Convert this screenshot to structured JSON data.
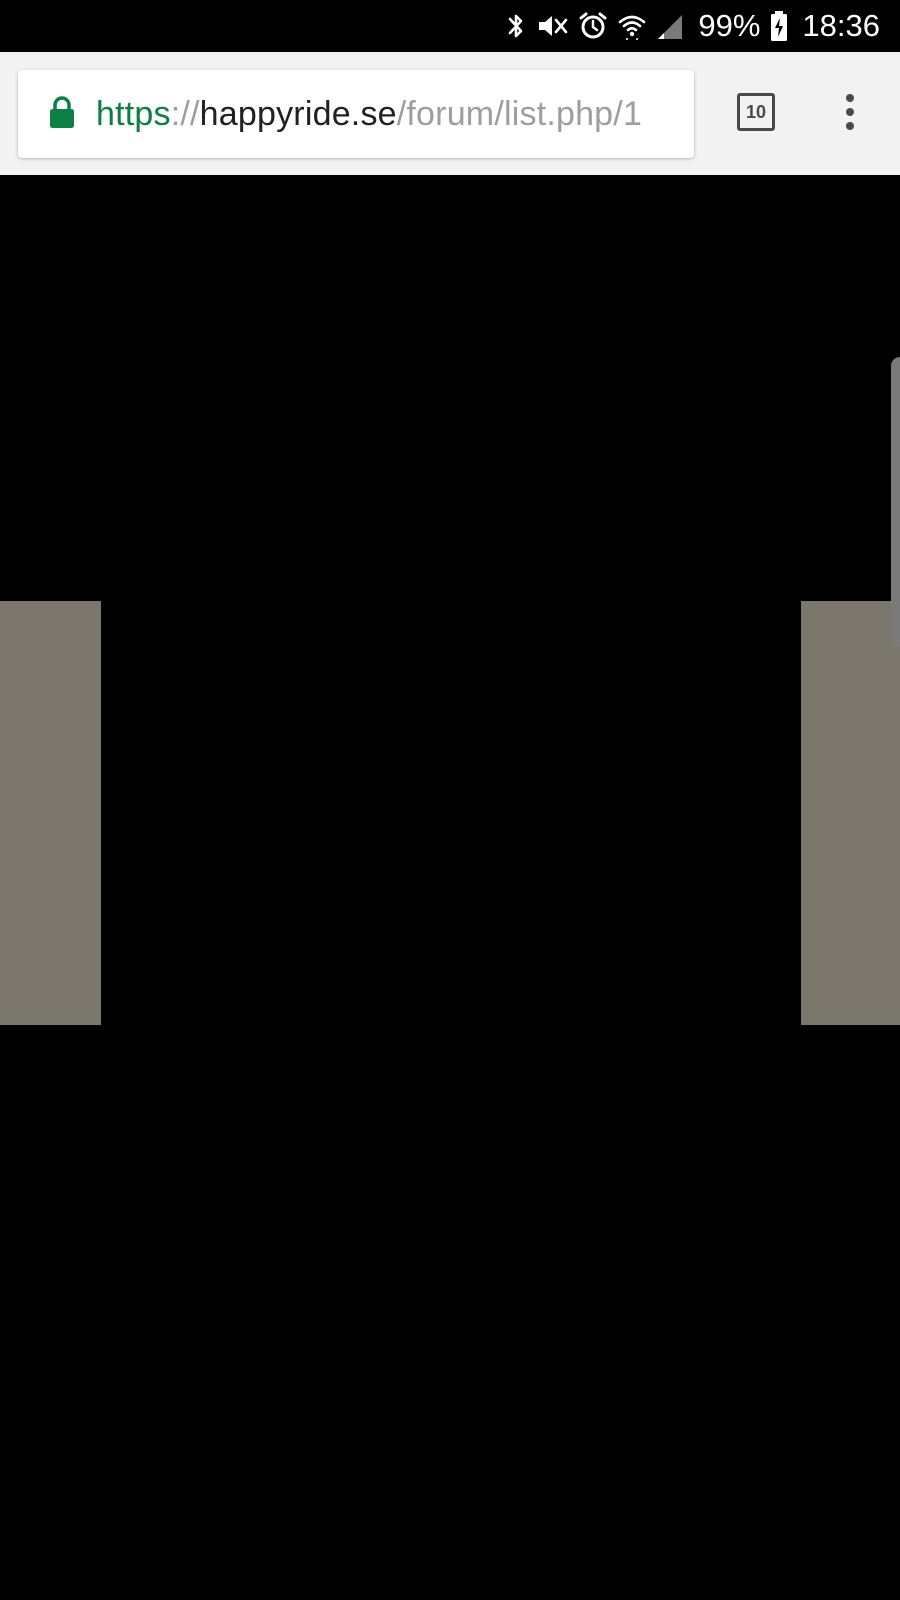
{
  "status_bar": {
    "battery_percent": "99%",
    "time": "18:36",
    "icons": [
      "bluetooth-icon",
      "mute-icon",
      "alarm-icon",
      "wifi-icon",
      "cell-signal-icon",
      "battery-charging-icon"
    ]
  },
  "browser": {
    "url": {
      "scheme": "https",
      "separator": "://",
      "host": "happyride.se",
      "path": "/forum/list.php/1"
    },
    "tab_count": "10"
  },
  "colors": {
    "url_scheme": "#0b8043",
    "page_background": "#000000",
    "side_panels": "#7b776c"
  }
}
